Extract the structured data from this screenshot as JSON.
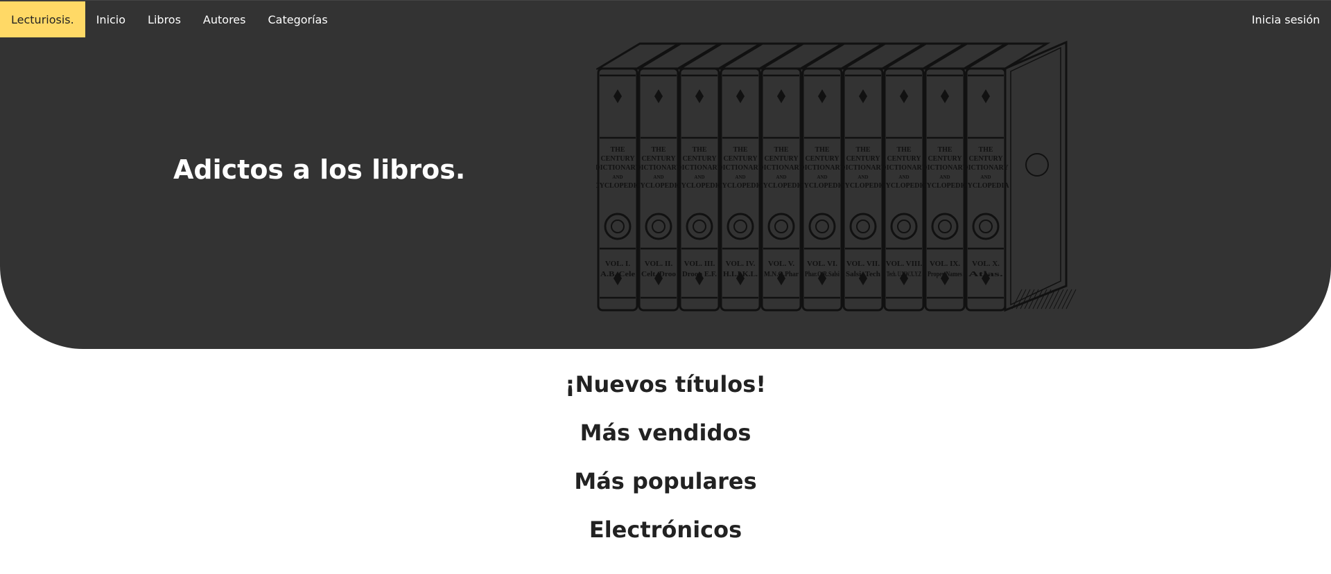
{
  "nav": {
    "brand": "Lecturiosis.",
    "links": [
      "Inicio",
      "Libros",
      "Autores",
      "Categorías"
    ],
    "login": "Inicia sesión"
  },
  "hero": {
    "headline": "Adictos a los libros.",
    "image_description": "engraved illustration of ten volumes of The Century Dictionary and Cyclopedia",
    "book_spines": [
      {
        "volume": "VOL. I.",
        "range": "A.B. Cele"
      },
      {
        "volume": "VOL. II.",
        "range": "Celt. Droo"
      },
      {
        "volume": "VOL. III.",
        "range": "Droop E.F."
      },
      {
        "volume": "VOL. IV.",
        "range": "H.I.J.K.L."
      },
      {
        "volume": "VOL. V.",
        "range": "M.N.O.Phar"
      },
      {
        "volume": "VOL. VI.",
        "range": "Phar.Q.R.Salsi"
      },
      {
        "volume": "VOL. VII.",
        "range": "Salsi. Tech"
      },
      {
        "volume": "VOL. VIII.",
        "range": "Tech. U.V.W.X.Y.Z"
      },
      {
        "volume": "VOL. IX.",
        "range": "Proper Names"
      },
      {
        "volume": "VOL. X.",
        "range": "Atlas."
      }
    ],
    "spine_title": [
      "THE",
      "CENTURY",
      "DICTIONARY",
      "AND",
      "CYCLOPEDIA"
    ]
  },
  "sections": [
    "¡Nuevos títulos!",
    "Más vendidos",
    "Más populares",
    "Electrónicos"
  ],
  "colors": {
    "hero_bg": "#333333",
    "brand_bg": "#ffd966",
    "text_dark": "#222222"
  }
}
